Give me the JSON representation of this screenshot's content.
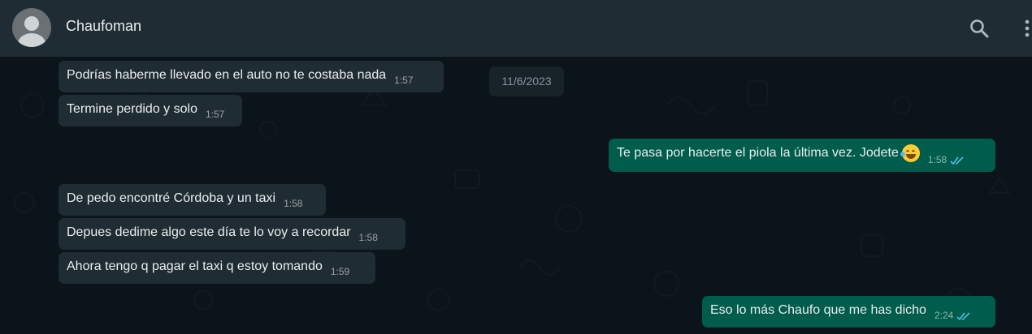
{
  "header": {
    "contact_name": "Chaufoman",
    "search_icon": "search-icon",
    "menu_icon": "more-vertical-icon",
    "avatar_icon": "default-avatar-icon"
  },
  "chat": {
    "date_chip": "11/6/2023",
    "messages": [
      {
        "direction": "incoming",
        "text": "Podrías haberme llevado en el auto no te costaba nada",
        "time": "1:57"
      },
      {
        "direction": "incoming",
        "text": "Termine perdido y solo",
        "time": "1:57"
      },
      {
        "direction": "outgoing",
        "text": "Te pasa por hacerte el piola la última vez. Jodete",
        "emoji": "rolling-on-floor-laughing-emoji",
        "time": "1:58",
        "status": "read"
      },
      {
        "direction": "incoming",
        "text": "De pedo encontré Córdoba y un taxi",
        "time": "1:58"
      },
      {
        "direction": "incoming",
        "text": "Depues dedime algo este día te lo voy a recordar",
        "time": "1:58"
      },
      {
        "direction": "incoming",
        "text": "Ahora tengo q pagar el taxi q estoy tomando",
        "time": "1:59"
      },
      {
        "direction": "outgoing",
        "text": "Eso lo más Chaufo que me has dicho",
        "time": "2:24",
        "status": "read"
      }
    ]
  },
  "colors": {
    "header_bg": "#202c33",
    "chat_bg": "#0b141a",
    "incoming_bubble": "#202c33",
    "outgoing_bubble": "#005c4b",
    "read_ticks": "#53bdeb"
  }
}
